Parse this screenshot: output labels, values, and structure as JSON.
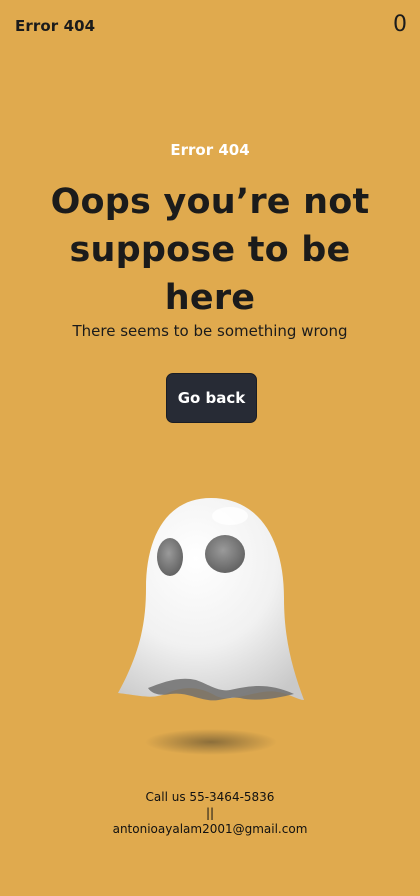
{
  "header": {
    "brand": "Error 404",
    "counter": "0"
  },
  "main": {
    "eyebrow": "Error 404",
    "headline": "Oops you’re not suppose to be here",
    "subline": "There seems to be something wrong",
    "button_label": "Go back"
  },
  "illustration": {
    "icon": "ghost-icon"
  },
  "footer": {
    "phone": "Call us 55-3464-5836",
    "separator": "||",
    "email": "antonioayalam2001@gmail.com"
  },
  "colors": {
    "background": "#E0AA4E",
    "button": "#272B35",
    "eyebrow_text": "#FFFFFF",
    "text": "#1B1B1B"
  }
}
